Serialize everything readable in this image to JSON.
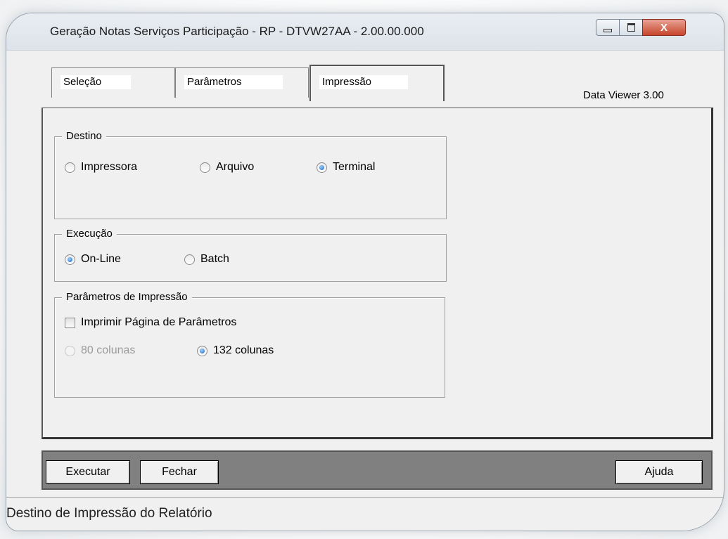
{
  "window": {
    "title": "Geração Notas Serviços Participação - RP - DTVW27AA - 2.00.00.000",
    "controls": {
      "close_glyph": "X"
    }
  },
  "tabs": [
    {
      "label": "Seleção",
      "active": false
    },
    {
      "label": "Parâmetros",
      "active": false
    },
    {
      "label": "Impressão",
      "active": true
    }
  ],
  "data_viewer": "Data Viewer 3.00",
  "destino": {
    "legend": "Destino",
    "options": [
      {
        "label": "Impressora",
        "selected": false
      },
      {
        "label": "Arquivo",
        "selected": false
      },
      {
        "label": "Terminal",
        "selected": true
      }
    ]
  },
  "execucao": {
    "legend": "Execução",
    "options": [
      {
        "label": "On-Line",
        "selected": true
      },
      {
        "label": "Batch",
        "selected": false
      }
    ]
  },
  "parametros_impressao": {
    "legend": "Parâmetros de Impressão",
    "checkbox_label": "Imprimir Página de Parâmetros",
    "checkbox_checked": false,
    "columns": [
      {
        "label": "80 colunas",
        "selected": false,
        "disabled": true
      },
      {
        "label": "132 colunas",
        "selected": true,
        "disabled": false
      }
    ]
  },
  "buttons": {
    "executar": "Executar",
    "fechar": "Fechar",
    "ajuda": "Ajuda"
  },
  "status": "Destino de Impressão do Relatório"
}
